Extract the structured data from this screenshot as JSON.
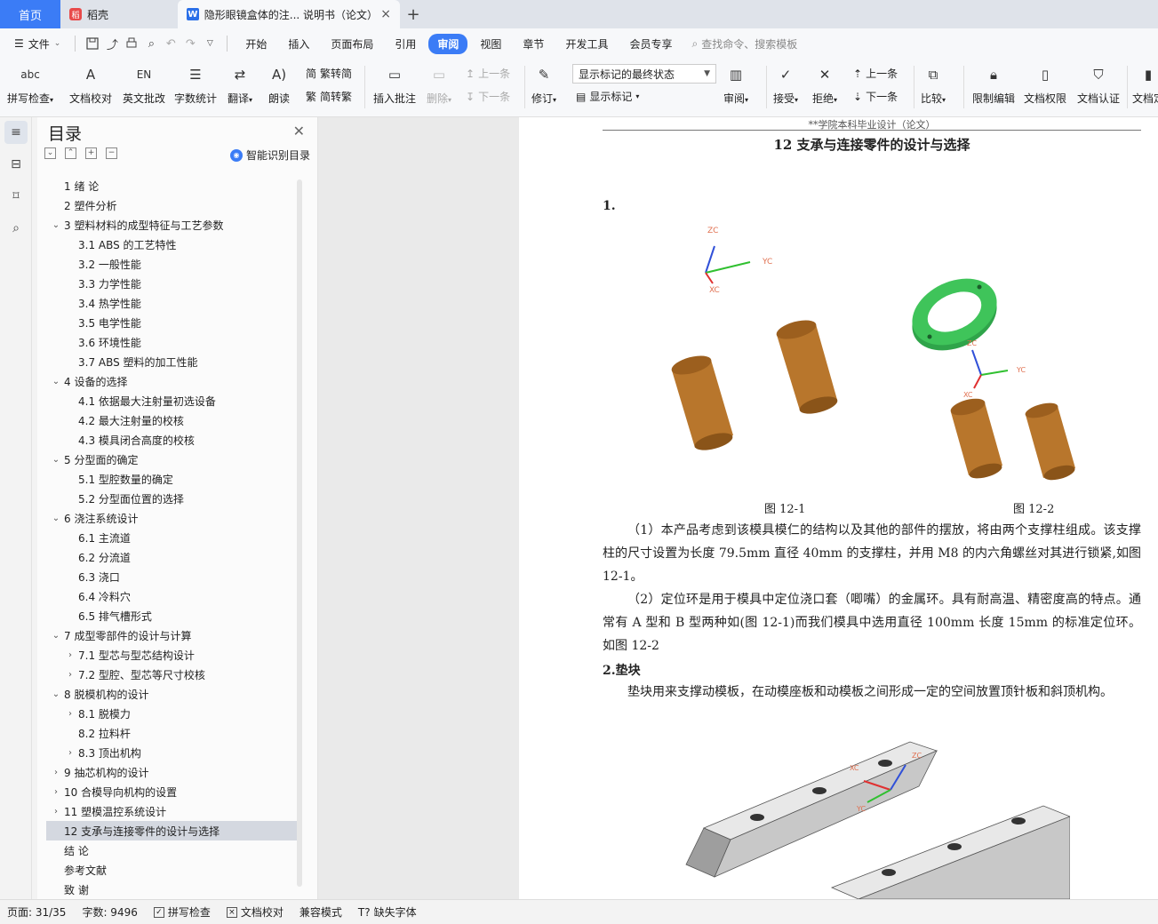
{
  "tabs": {
    "home": "首页",
    "daoke": "稻壳",
    "doc": "隐形眼镜盒体的注... 说明书（论文）",
    "close": "×",
    "add": "+"
  },
  "menu": {
    "file": "文件",
    "items": [
      "开始",
      "插入",
      "页面布局",
      "引用",
      "审阅",
      "视图",
      "章节",
      "开发工具",
      "会员专享"
    ],
    "search": "查找命令、搜索模板"
  },
  "ribbon": {
    "spell": "拼写检查",
    "proof": "文档校对",
    "en": "英文批改",
    "count": "字数统计",
    "translate": "翻译",
    "read": "朗读",
    "t2s": "繁转简",
    "s2t": "简转繁",
    "insert_comment": "插入批注",
    "delete": "删除",
    "prev_comment": "上一条",
    "next_comment": "下一条",
    "revise": "修订",
    "display_mode": "显示标记的最终状态",
    "show_marks": "显示标记",
    "review": "审阅",
    "accept": "接受",
    "reject": "拒绝",
    "prev": "上一条",
    "next": "下一条",
    "compare": "比较",
    "restrict": "限制编辑",
    "rights": "文档权限",
    "cert": "文档认证",
    "last": "文档定"
  },
  "toc": {
    "title": "目录",
    "smart": "智能识别目录",
    "items": [
      {
        "label": "1  绪  论",
        "level": 1,
        "chev": ""
      },
      {
        "label": "2  塑件分析",
        "level": 1,
        "chev": ""
      },
      {
        "label": "3  塑料材料的成型特征与工艺参数",
        "level": 1,
        "chev": "v"
      },
      {
        "label": "3.1 ABS 的工艺特性",
        "level": 2,
        "chev": ""
      },
      {
        "label": "3.2  一般性能",
        "level": 2,
        "chev": ""
      },
      {
        "label": "3.3  力学性能",
        "level": 2,
        "chev": ""
      },
      {
        "label": "3.4  热学性能",
        "level": 2,
        "chev": ""
      },
      {
        "label": "3.5  电学性能",
        "level": 2,
        "chev": ""
      },
      {
        "label": "3.6  环境性能",
        "level": 2,
        "chev": ""
      },
      {
        "label": "3.7 ABS 塑料的加工性能",
        "level": 2,
        "chev": ""
      },
      {
        "label": "4  设备的选择",
        "level": 1,
        "chev": "v"
      },
      {
        "label": "4.1  依据最大注射量初选设备",
        "level": 2,
        "chev": ""
      },
      {
        "label": "4.2  最大注射量的校核",
        "level": 2,
        "chev": ""
      },
      {
        "label": "4.3  模具闭合高度的校核",
        "level": 2,
        "chev": ""
      },
      {
        "label": "5  分型面的确定",
        "level": 1,
        "chev": "v"
      },
      {
        "label": "5.1  型腔数量的确定",
        "level": 2,
        "chev": ""
      },
      {
        "label": "5.2  分型面位置的选择",
        "level": 2,
        "chev": ""
      },
      {
        "label": "6  浇注系统设计",
        "level": 1,
        "chev": "v"
      },
      {
        "label": "6.1  主流道",
        "level": 2,
        "chev": ""
      },
      {
        "label": "6.2  分流道",
        "level": 2,
        "chev": ""
      },
      {
        "label": "6.3  浇口",
        "level": 2,
        "chev": ""
      },
      {
        "label": "6.4  冷料穴",
        "level": 2,
        "chev": ""
      },
      {
        "label": "6.5  排气槽形式",
        "level": 2,
        "chev": ""
      },
      {
        "label": "7  成型零部件的设计与计算",
        "level": 1,
        "chev": "v"
      },
      {
        "label": "7.1  型芯与型芯结构设计",
        "level": 2,
        "chev": ">"
      },
      {
        "label": "7.2  型腔、型芯等尺寸校核",
        "level": 2,
        "chev": ">"
      },
      {
        "label": "8  脱模机构的设计",
        "level": 1,
        "chev": "v"
      },
      {
        "label": "8.1  脱模力",
        "level": 2,
        "chev": ">"
      },
      {
        "label": "8.2  拉料杆",
        "level": 2,
        "chev": ""
      },
      {
        "label": "8.3  顶出机构",
        "level": 2,
        "chev": ">"
      },
      {
        "label": "9  抽芯机构的设计",
        "level": 1,
        "chev": ">"
      },
      {
        "label": "10  合模导向机构的设置",
        "level": 1,
        "chev": ">"
      },
      {
        "label": "11  塑模温控系统设计",
        "level": 1,
        "chev": ">"
      },
      {
        "label": "12  支承与连接零件的设计与选择",
        "level": 1,
        "chev": "",
        "selected": true
      },
      {
        "label": "结  论",
        "level": 1,
        "chev": ""
      },
      {
        "label": "参考文献",
        "level": 1,
        "chev": ""
      },
      {
        "label": "致  谢",
        "level": 1,
        "chev": ""
      }
    ]
  },
  "page": {
    "header": "**学院本科毕业设计（论文）",
    "title": "12  支承与连接零件的设计与选择",
    "sec1": "1.",
    "fig1": "图 12-1",
    "fig2": "图 12-2",
    "para1": "（1）本产品考虑到该模具模仁的结构以及其他的部件的摆放，将由两个支撑柱组成。该支撑柱的尺寸设置为长度 79.5mm 直径 40mm  的支撑柱，并用 M8 的内六角螺丝对其进行锁紧,如图 12-1。",
    "para2": "（2）定位环是用于模具中定位浇口套（唧嘴）的金属环。具有耐高温、精密度高的特点。通常有 A 型和 B 型两种如(图 12-1)而我们模具中选用直径 100mm    长度 15mm 的标准定位环。如图 12-2",
    "sec2": "2.垫块",
    "para3": "垫块用来支撑动模板，在动模座板和动模板之间形成一定的空间放置顶针板和斜顶机构。",
    "axis": {
      "zc": "ZC",
      "yc": "YC",
      "xc": "XC"
    }
  },
  "status": {
    "page": "页面: 31/35",
    "words": "字数: 9496",
    "spell": "拼写检查",
    "proof": "文档校对",
    "compat": "兼容模式",
    "font": "缺失字体"
  },
  "icons": [
    "menu-icon",
    "save-icon",
    "print-icon",
    "undo-icon",
    "redo-icon",
    "search-icon",
    "bookmark-icon",
    "outline-icon",
    "nav-icon"
  ]
}
